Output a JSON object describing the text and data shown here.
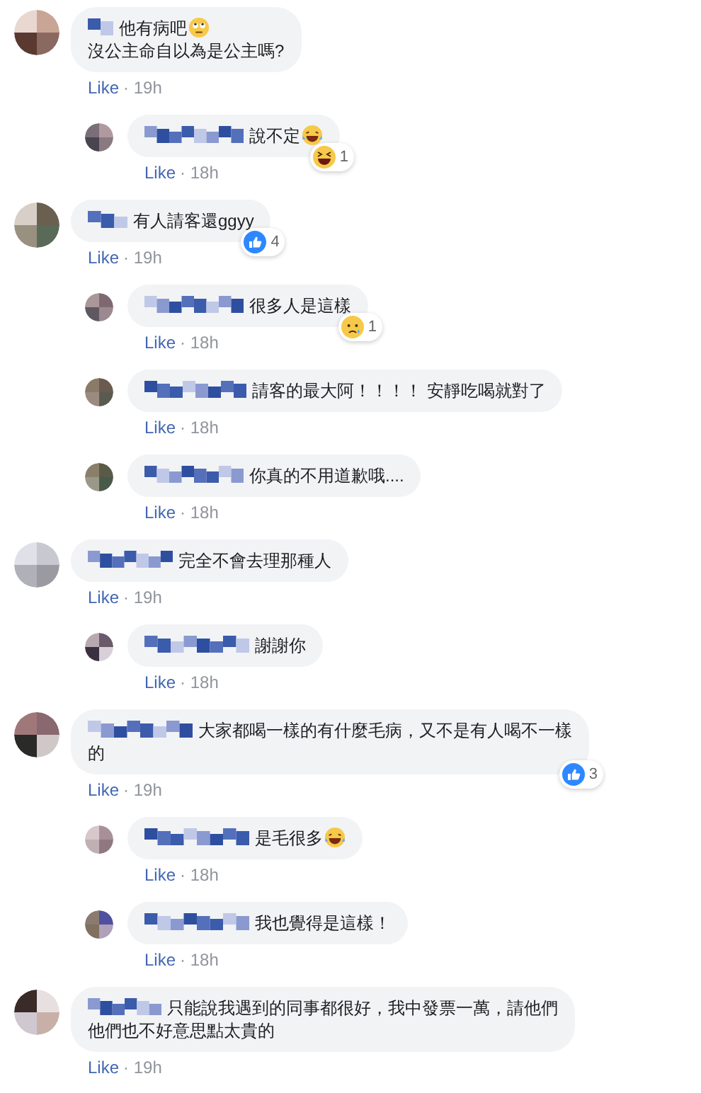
{
  "comments": [
    {
      "reply": false,
      "lines": [
        {
          "text": "他有病吧",
          "kind": "roll-eyes"
        },
        {
          "text": "沒公主命自以為是公主嗎?",
          "kind": "plain"
        }
      ],
      "like": "Like",
      "time": "· 19h"
    },
    {
      "reply": true,
      "lines": [
        {
          "text": "說不定",
          "kind": "laugh-tears"
        }
      ],
      "reaction": {
        "kind": "haha",
        "count": "1"
      },
      "like": "Like",
      "time": "· 18h"
    },
    {
      "reply": false,
      "lines": [
        {
          "text": "有人請客還ggyy",
          "kind": "plain"
        }
      ],
      "reaction": {
        "kind": "like",
        "count": "4"
      },
      "like": "Like",
      "time": "· 19h"
    },
    {
      "reply": true,
      "lines": [
        {
          "text": "很多人是這樣",
          "kind": "plain"
        }
      ],
      "reaction": {
        "kind": "sad",
        "count": "1"
      },
      "like": "Like",
      "time": "· 18h"
    },
    {
      "reply": true,
      "lines": [
        {
          "text": "請客的最大阿！！！！ 安靜吃喝就對了",
          "kind": "plain"
        }
      ],
      "like": "Like",
      "time": "· 18h"
    },
    {
      "reply": true,
      "lines": [
        {
          "text": "你真的不用道歉哦....",
          "kind": "plain"
        }
      ],
      "like": "Like",
      "time": "· 18h"
    },
    {
      "reply": false,
      "lines": [
        {
          "text": "完全不會去理那種人",
          "kind": "plain"
        }
      ],
      "like": "Like",
      "time": "· 19h"
    },
    {
      "reply": true,
      "lines": [
        {
          "text": "謝謝你",
          "kind": "plain"
        }
      ],
      "like": "Like",
      "time": "· 18h"
    },
    {
      "reply": false,
      "lines": [
        {
          "text": "大家都喝一樣的有什麼毛病，又不是有人喝不一樣",
          "kind": "plain"
        },
        {
          "text": "的",
          "kind": "plain"
        }
      ],
      "reaction": {
        "kind": "like",
        "count": "3"
      },
      "like": "Like",
      "time": "· 19h"
    },
    {
      "reply": true,
      "lines": [
        {
          "text": "是毛很多",
          "kind": "laugh-tears"
        }
      ],
      "like": "Like",
      "time": "· 18h"
    },
    {
      "reply": true,
      "lines": [
        {
          "text": "我也覺得是這樣！",
          "kind": "plain"
        }
      ],
      "like": "Like",
      "time": "· 18h"
    },
    {
      "reply": false,
      "lines": [
        {
          "text": "只能說我遇到的同事都很好，我中發票一萬，請他們",
          "kind": "plain"
        },
        {
          "text": "他們也不好意思點太貴的",
          "kind": "plain"
        }
      ],
      "like": "Like",
      "time": "· 19h"
    }
  ]
}
